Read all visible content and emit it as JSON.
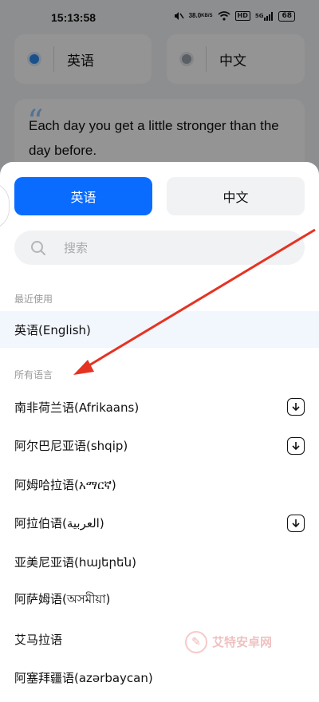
{
  "status_bar": {
    "time": "15:13:58",
    "net_speed_value": "38.0",
    "net_speed_unit": "KB/S",
    "hd_label": "HD",
    "signal_label": "5G",
    "battery": "68"
  },
  "background": {
    "source_lang": "英语",
    "target_lang": "中文",
    "source_text": "Each day you get a little stronger than the day before."
  },
  "sheet": {
    "tabs": [
      {
        "label": "英语",
        "active": true
      },
      {
        "label": "中文",
        "active": false
      }
    ],
    "search": {
      "placeholder": "搜索"
    },
    "recent_header": "最近使用",
    "recent": [
      {
        "label": "英语(English)"
      }
    ],
    "all_header": "所有语言",
    "languages": [
      {
        "label": "南非荷兰语(Afrikaans)",
        "download": true
      },
      {
        "label": "阿尔巴尼亚语(shqip)",
        "download": true
      },
      {
        "label": "阿姆哈拉语(አማርኛ)",
        "download": false
      },
      {
        "label": "阿拉伯语(العربية)",
        "download": true
      },
      {
        "label": "亚美尼亚语(հայերեն)",
        "download": false
      },
      {
        "label": "阿萨姆语(অসমীয়া)",
        "download": false
      },
      {
        "label": "艾马拉语",
        "download": false
      },
      {
        "label": "阿塞拜疆语(azərbaycan)",
        "download": false
      }
    ]
  },
  "watermark": {
    "text": "艾特安卓网"
  },
  "colors": {
    "accent": "#0a6cff",
    "annotation_arrow": "#e53322"
  }
}
